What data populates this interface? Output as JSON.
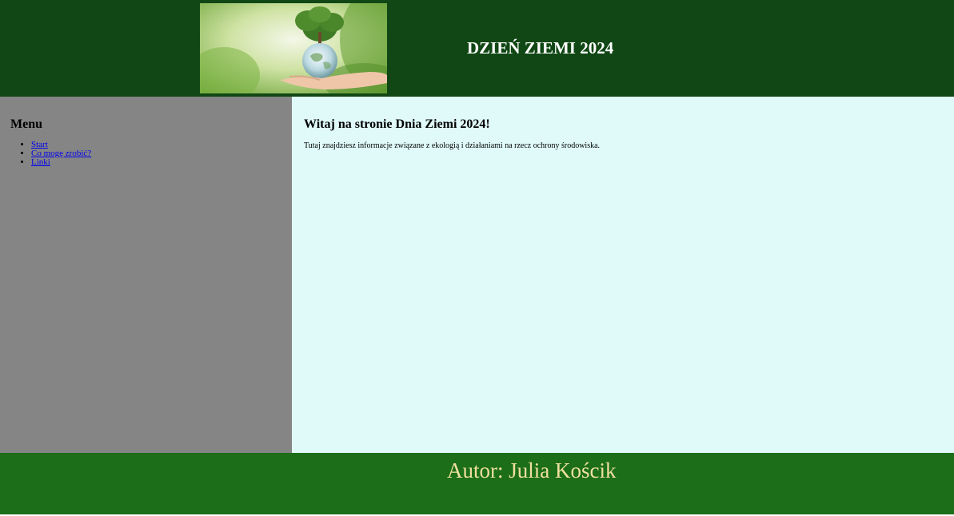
{
  "header": {
    "title": "DZIEŃ ZIEMI 2024"
  },
  "sidebar": {
    "heading": "Menu",
    "items": [
      {
        "label": "Start"
      },
      {
        "label": "Co mogę zrobić?"
      },
      {
        "label": "Linki"
      }
    ]
  },
  "main": {
    "heading": "Witaj na stronie Dnia Ziemi 2024!",
    "text": "Tutaj znajdziesz informacje związane z ekologią i działaniami na rzecz ochrony środowiska."
  },
  "footer": {
    "author": "Autor: Julia Kościk"
  },
  "colors": {
    "header_bg": "#104714",
    "sidebar_bg": "#858585",
    "main_bg": "#e0fafa",
    "footer_bg": "#1d6e18",
    "author_text": "#f0e0a0",
    "link": "#0000ee"
  },
  "icons": {
    "hero_image": "hand-holding-globe-with-tree-image"
  }
}
